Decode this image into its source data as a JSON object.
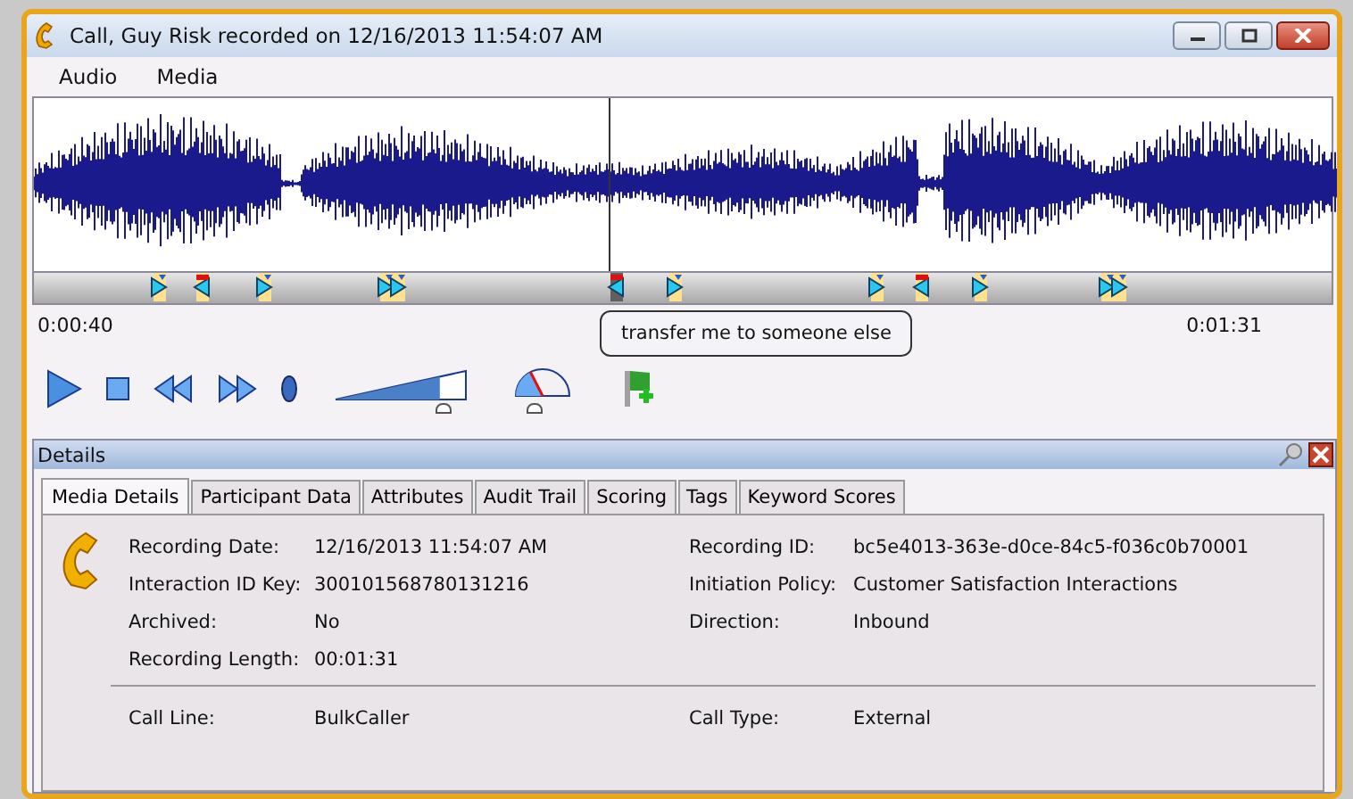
{
  "window": {
    "title": "Call, Guy Risk recorded on 12/16/2013 11:54:07 AM"
  },
  "menu": [
    "Audio",
    "Media"
  ],
  "player": {
    "playhead": {
      "level": 0.443
    },
    "start_time": "0:00:40",
    "end_time": "0:01:31",
    "tooltip": "transfer me to someone else",
    "volume": {
      "level": 0.8
    },
    "speed": {
      "level": 0.35
    }
  },
  "details": {
    "title": "Details",
    "tabs": [
      {
        "label": "Media Details",
        "selected": true
      },
      {
        "label": "Participant Data",
        "selected": false
      },
      {
        "label": "Attributes",
        "selected": false
      },
      {
        "label": "Audit Trail",
        "selected": false
      },
      {
        "label": "Scoring",
        "selected": false
      },
      {
        "label": "Tags",
        "selected": false
      },
      {
        "label": "Keyword Scores",
        "selected": false
      }
    ],
    "sections": [
      [
        {
          "label": "Recording Date:",
          "value": "12/16/2013 11:54:07 AM"
        },
        {
          "label": "Recording ID:",
          "value": "bc5e4013-363e-d0ce-84c5-f036c0b70001"
        },
        {
          "label": "Interaction ID Key:",
          "value": "300101568780131216"
        },
        {
          "label": "Initiation Policy:",
          "value": "Customer Satisfaction Interactions"
        },
        {
          "label": "Archived:",
          "value": "No"
        },
        {
          "label": "Direction:",
          "value": "Inbound"
        },
        {
          "label": "Recording Length:",
          "value": "00:01:31"
        }
      ],
      [
        {
          "label": "Call Line:",
          "value": "BulkCaller"
        },
        {
          "label": "Call Type:",
          "value": "External"
        }
      ]
    ]
  }
}
